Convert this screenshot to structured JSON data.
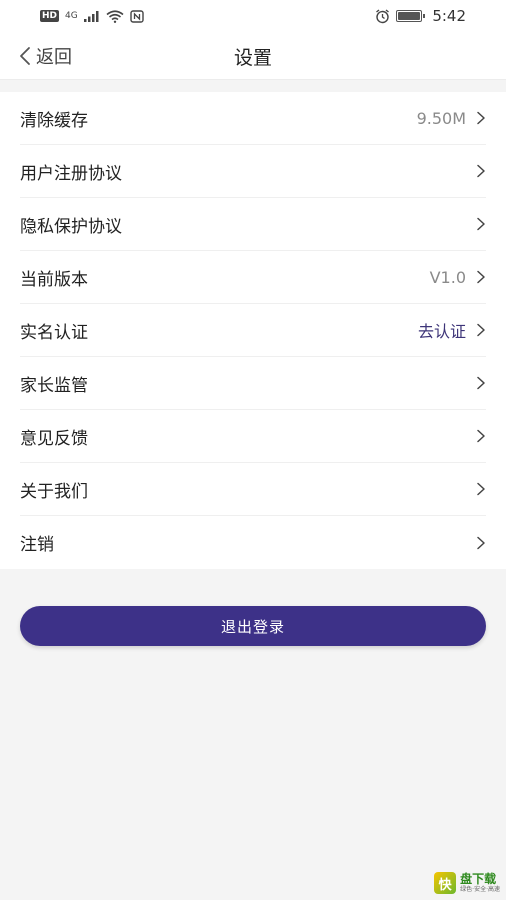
{
  "status_bar": {
    "left": {
      "hd": "HD",
      "network": "4G"
    },
    "time": "5:42",
    "icons": [
      "hd-icon",
      "signal-icon",
      "wifi-icon",
      "alarm-icon",
      "battery-icon"
    ]
  },
  "nav": {
    "back_label": "返回",
    "title": "设置"
  },
  "settings": {
    "items": [
      {
        "label": "清除缓存",
        "value": "9.50M",
        "accent": false
      },
      {
        "label": "用户注册协议",
        "value": "",
        "accent": false
      },
      {
        "label": "隐私保护协议",
        "value": "",
        "accent": false
      },
      {
        "label": "当前版本",
        "value": "V1.0",
        "accent": false
      },
      {
        "label": "实名认证",
        "value": "去认证",
        "accent": true
      },
      {
        "label": "家长监管",
        "value": "",
        "accent": false
      },
      {
        "label": "意见反馈",
        "value": "",
        "accent": false
      },
      {
        "label": "关于我们",
        "value": "",
        "accent": false
      },
      {
        "label": "注销",
        "value": "",
        "accent": false
      }
    ]
  },
  "logout_label": "退出登录",
  "watermark": {
    "logo_char": "快",
    "title": "盘下载",
    "sub": "绿色·安全·高速"
  },
  "colors": {
    "primary": "#3d3188",
    "accent_text": "#3d3478",
    "background": "#f4f4f4",
    "surface": "#ffffff"
  }
}
